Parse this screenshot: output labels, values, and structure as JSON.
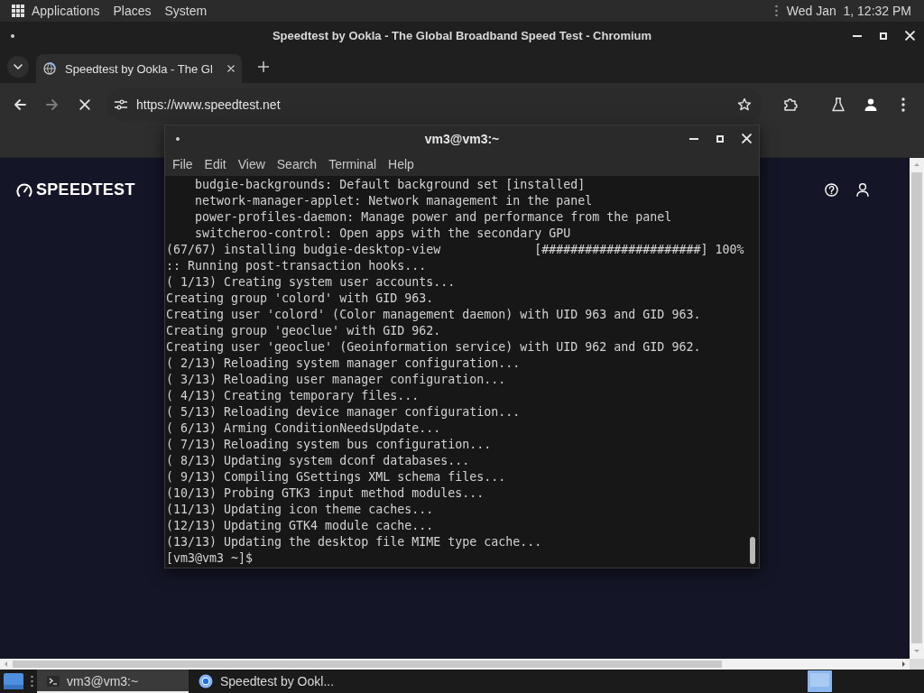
{
  "top_panel": {
    "menus": [
      "Applications",
      "Places",
      "System"
    ],
    "clock": "Wed Jan  1, 12:32 PM"
  },
  "browser": {
    "title": "Speedtest by Ookla - The Global Broadband Speed Test - Chromium",
    "tabs": [
      {
        "label": "Speedtest by Ookla - The Gl",
        "selected": true
      }
    ],
    "nav_buttons": [
      {
        "kind": "back",
        "disabled": false
      },
      {
        "kind": "forward",
        "disabled": true
      },
      {
        "kind": "stop",
        "disabled": false
      }
    ],
    "address": "https://www.speedtest.net",
    "page": {
      "logo": "SPEEDTEST"
    }
  },
  "terminal": {
    "title": "vm3@vm3:~",
    "menus": [
      "File",
      "Edit",
      "View",
      "Search",
      "Terminal",
      "Help"
    ],
    "lines": [
      "    budgie-backgrounds: Default background set [installed]",
      "    network-manager-applet: Network management in the panel",
      "    power-profiles-daemon: Manage power and performance from the panel",
      "    switcheroo-control: Open apps with the secondary GPU",
      "(67/67) installing budgie-desktop-view             [######################] 100%",
      ":: Running post-transaction hooks...",
      "( 1/13) Creating system user accounts...",
      "Creating group 'colord' with GID 963.",
      "Creating user 'colord' (Color management daemon) with UID 963 and GID 963.",
      "Creating group 'geoclue' with GID 962.",
      "Creating user 'geoclue' (Geoinformation service) with UID 962 and GID 962.",
      "( 2/13) Reloading system manager configuration...",
      "( 3/13) Reloading user manager configuration...",
      "( 4/13) Creating temporary files...",
      "( 5/13) Reloading device manager configuration...",
      "( 6/13) Arming ConditionNeedsUpdate...",
      "( 7/13) Reloading system bus configuration...",
      "( 8/13) Updating system dconf databases...",
      "( 9/13) Compiling GSettings XML schema files...",
      "(10/13) Probing GTK3 input method modules...",
      "(11/13) Updating icon theme caches...",
      "(12/13) Updating GTK4 module cache...",
      "(13/13) Updating the desktop file MIME type cache...",
      "[vm3@vm3 ~]$"
    ]
  },
  "taskbar": {
    "tasks": [
      {
        "kind": "terminal",
        "label": "vm3@vm3:~",
        "selected": true
      },
      {
        "kind": "browser",
        "label": "Speedtest by Ookl...",
        "selected": false
      }
    ]
  }
}
